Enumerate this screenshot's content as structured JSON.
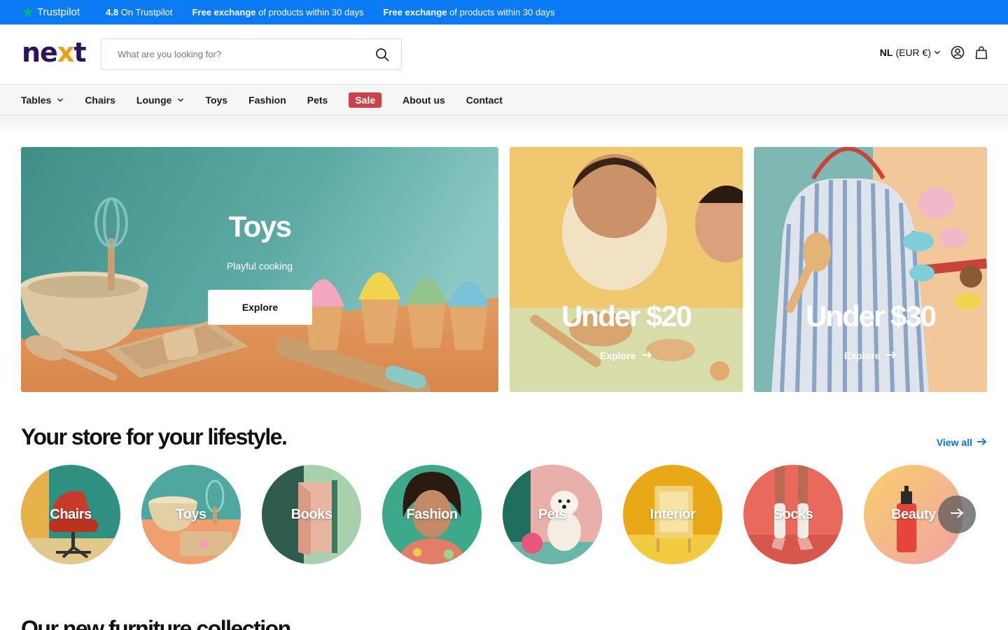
{
  "topbar": {
    "brand": "Trustpilot",
    "rating": "4.8",
    "rating_suffix": "On Trustpilot",
    "promos": [
      {
        "bold": "Free exchange",
        "rest": "of products within 30 days"
      },
      {
        "bold": "Free exchange",
        "rest": "of products within 30 days"
      }
    ]
  },
  "header": {
    "logo": {
      "pre": "ne",
      "x": "x",
      "post": "t"
    },
    "search_placeholder": "What are you looking for?",
    "locale_code": "NL",
    "locale_currency": "(EUR €)"
  },
  "nav": {
    "items": [
      {
        "label": "Tables",
        "dropdown": true
      },
      {
        "label": "Chairs"
      },
      {
        "label": "Lounge",
        "dropdown": true
      },
      {
        "label": "Toys"
      },
      {
        "label": "Fashion"
      },
      {
        "label": "Pets"
      },
      {
        "label": "Sale"
      },
      {
        "label": "About us"
      },
      {
        "label": "Contact"
      }
    ]
  },
  "hero": {
    "main": {
      "title": "Toys",
      "subtitle": "Playful cooking",
      "button": "Explore"
    },
    "b": {
      "title": "Under $20",
      "link": "Explore"
    },
    "c": {
      "title": "Under $30",
      "link": "Explore"
    }
  },
  "lifestyle": {
    "title": "Your store for your lifestyle.",
    "view_all": "View all",
    "categories": [
      "Chairs",
      "Toys",
      "Books",
      "Fashion",
      "Pets",
      "Interior",
      "Socks",
      "Beauty"
    ]
  },
  "next_section": {
    "title": "Our new furniture collection"
  },
  "colors": {
    "topbar": "#0a7bf5",
    "sale": "#c9434a",
    "link": "#0a6fe0",
    "logo": "#2a1460"
  }
}
